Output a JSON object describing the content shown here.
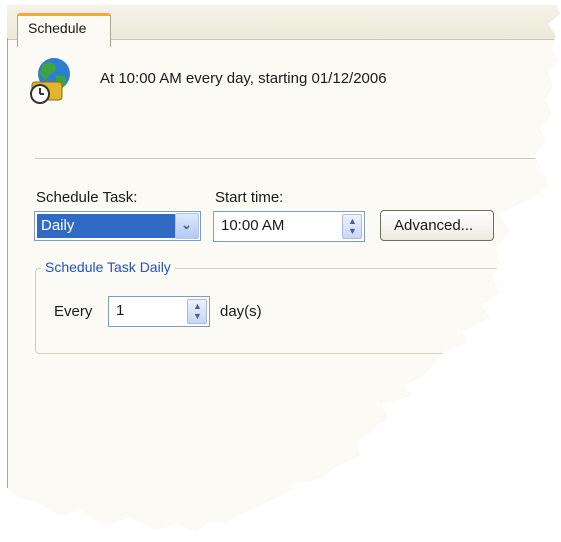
{
  "tabs": [
    {
      "label": "Schedule",
      "active": true
    }
  ],
  "summary": {
    "icon": "globe-clock-icon",
    "text": "At 10:00 AM every day, starting 01/12/2006"
  },
  "schedule_task": {
    "label": "Schedule Task:",
    "value": "Daily"
  },
  "start_time": {
    "label": "Start time:",
    "value": "10:00 AM"
  },
  "advanced_button": {
    "label": "Advanced..."
  },
  "daily_group": {
    "legend": "Schedule Task Daily",
    "every_label": "Every",
    "every_value": "1",
    "unit_label": "day(s)"
  },
  "colors": {
    "tab_accent": "#f2a93b",
    "selection": "#316ac5",
    "group_legend": "#2151c4"
  }
}
